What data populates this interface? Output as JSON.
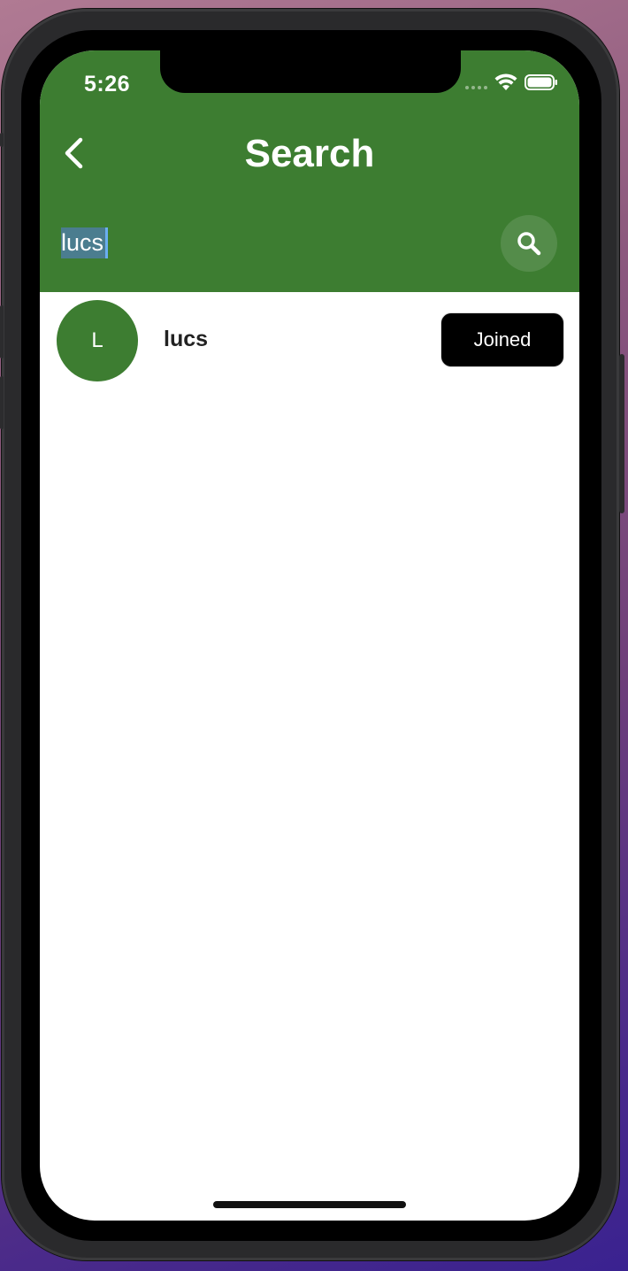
{
  "status_bar": {
    "time": "5:26"
  },
  "header": {
    "title": "Search",
    "back_icon": "chevron-left-icon",
    "background_color": "#3d7d31"
  },
  "search": {
    "value": "lucs",
    "button_icon": "search-icon"
  },
  "results": [
    {
      "avatar_initial": "L",
      "name": "lucs",
      "action_label": "Joined"
    }
  ],
  "colors": {
    "accent": "#3d7d31",
    "button": "#000000"
  }
}
